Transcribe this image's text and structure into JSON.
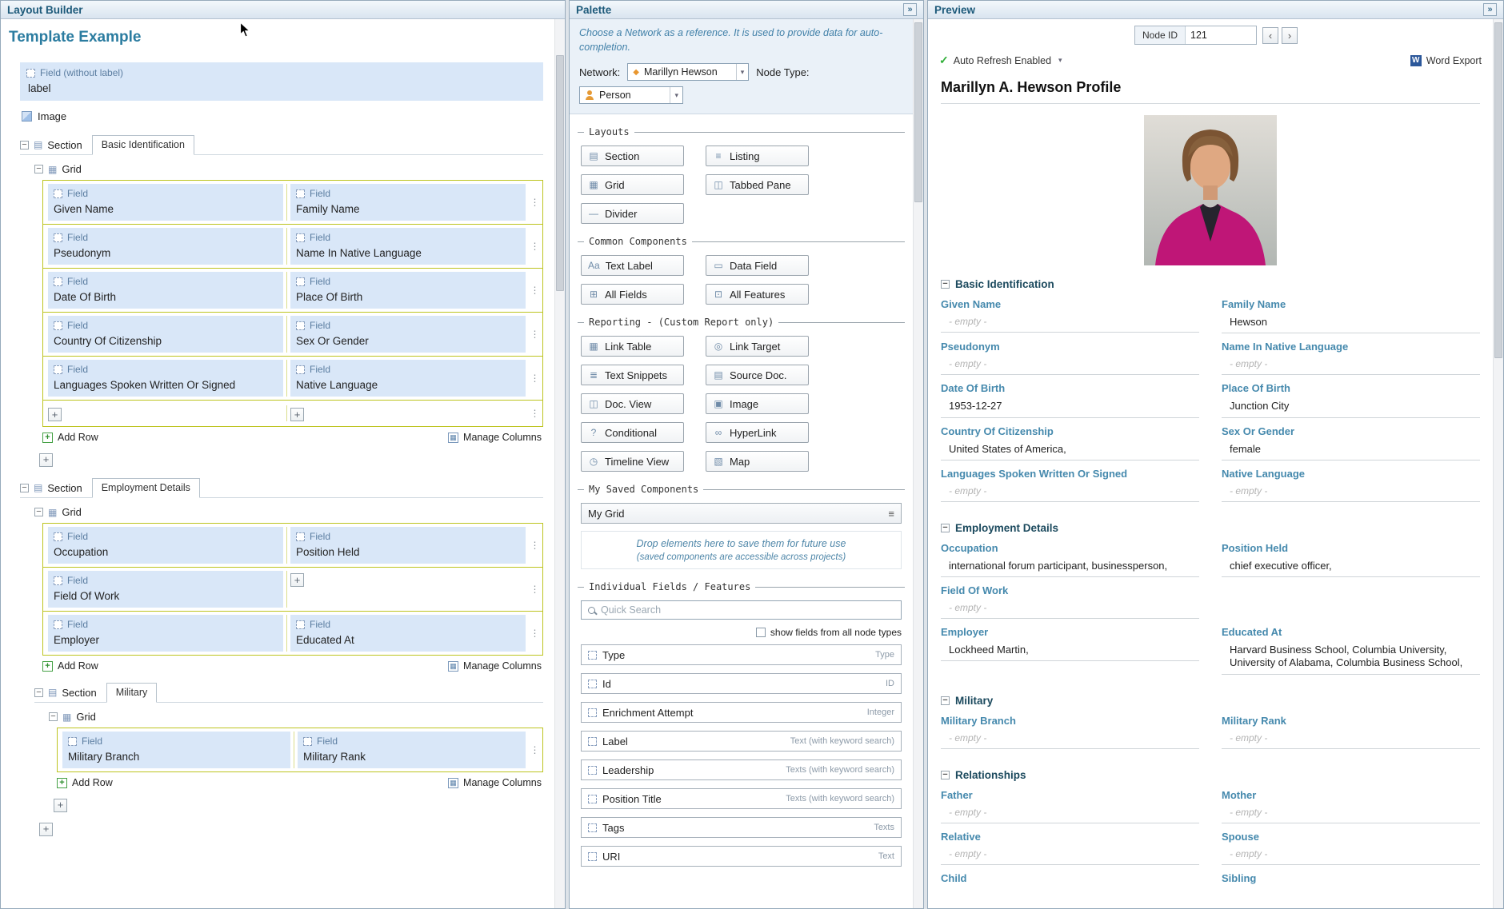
{
  "icons": {
    "collapse_panel": "»",
    "caret_down": "▾",
    "collapse_minus": "−",
    "drag_dots": "⋮",
    "plus": "+",
    "check": "✓",
    "hamburger": "≡",
    "prev_node": "‹",
    "next_node": "›",
    "section_tree": "▤",
    "grid_tree": "▦",
    "manage_columns": "▦",
    "word_export": "W",
    "network": "◆"
  },
  "layout_builder": {
    "title": "Layout Builder",
    "subtitle": "Template Example",
    "field_no_label": {
      "type_label": "Field (without label)",
      "value": "label"
    },
    "image_label": "Image",
    "section_label": "Section",
    "grid_label": "Grid",
    "field_label": "Field",
    "add_row_label": "Add Row",
    "manage_columns_label": "Manage Columns",
    "sections": [
      {
        "name": "Basic Identification",
        "plus_row": true,
        "rows": [
          [
            {
              "name": "Given Name"
            },
            {
              "name": "Family Name"
            }
          ],
          [
            {
              "name": "Pseudonym"
            },
            {
              "name": "Name In Native Language"
            }
          ],
          [
            {
              "name": "Date Of Birth"
            },
            {
              "name": "Place Of Birth"
            }
          ],
          [
            {
              "name": "Country Of Citizenship"
            },
            {
              "name": "Sex Or Gender"
            }
          ],
          [
            {
              "name": "Languages Spoken Written Or Signed"
            },
            {
              "name": "Native Language"
            }
          ]
        ]
      },
      {
        "name": "Employment Details",
        "plus_row": false,
        "rows": [
          [
            {
              "name": "Occupation"
            },
            {
              "name": "Position Held"
            }
          ],
          [
            {
              "name": "Field Of Work"
            },
            {
              "plus": true
            }
          ],
          [
            {
              "name": "Employer"
            },
            {
              "name": "Educated At"
            }
          ]
        ]
      },
      {
        "name": "Military",
        "plus_row": false,
        "rows": [
          [
            {
              "name": "Military Branch"
            },
            {
              "name": "Military Rank"
            }
          ]
        ]
      }
    ]
  },
  "palette": {
    "title": "Palette",
    "info_text": "Choose a Network as a reference. It is used to provide data for auto-completion.",
    "network_label": "Network:",
    "network_value": "Marillyn Hewson",
    "node_type_label": "Node Type:",
    "node_type_value": "Person",
    "groups": [
      {
        "title": "Layouts",
        "buttons": [
          {
            "label": "Section",
            "name": "palette-button-section",
            "icon": "section-layout-icon",
            "glyph": "▤"
          },
          {
            "label": "Listing",
            "name": "palette-button-listing",
            "icon": "listing-icon",
            "glyph": "≡"
          },
          {
            "label": "Grid",
            "name": "palette-button-grid",
            "icon": "grid-layout-icon",
            "glyph": "▦"
          },
          {
            "label": "Tabbed Pane",
            "name": "palette-button-tabbed-pane",
            "icon": "tabbed-pane-icon",
            "glyph": "◫"
          },
          {
            "label": "Divider",
            "name": "palette-button-divider",
            "icon": "divider-icon",
            "glyph": "—"
          }
        ]
      },
      {
        "title": "Common Components",
        "buttons": [
          {
            "label": "Text Label",
            "name": "palette-button-text-label",
            "icon": "text-label-icon",
            "glyph": "Aa"
          },
          {
            "label": "Data Field",
            "name": "palette-button-data-field",
            "icon": "data-field-icon",
            "glyph": "▭"
          },
          {
            "label": "All Fields",
            "name": "palette-button-all-fields",
            "icon": "all-fields-icon",
            "glyph": "⊞"
          },
          {
            "label": "All Features",
            "name": "palette-button-all-features",
            "icon": "all-features-icon",
            "glyph": "⊡"
          }
        ]
      },
      {
        "title": "Reporting - (Custom Report only)",
        "buttons": [
          {
            "label": "Link Table",
            "name": "palette-button-link-table",
            "icon": "link-table-icon",
            "glyph": "▦"
          },
          {
            "label": "Link Target",
            "name": "palette-button-link-target",
            "icon": "link-target-icon",
            "glyph": "◎"
          },
          {
            "label": "Text Snippets",
            "name": "palette-button-text-snippets",
            "icon": "text-snippets-icon",
            "glyph": "≣"
          },
          {
            "label": "Source Doc.",
            "name": "palette-button-source-doc",
            "icon": "source-doc-icon",
            "glyph": "▤"
          },
          {
            "label": "Doc. View",
            "name": "palette-button-doc-view",
            "icon": "doc-view-icon",
            "glyph": "◫"
          },
          {
            "label": "Image",
            "name": "palette-button-image",
            "icon": "image-icon",
            "glyph": "▣"
          },
          {
            "label": "Conditional",
            "name": "palette-button-conditional",
            "icon": "conditional-icon",
            "glyph": "?"
          },
          {
            "label": "HyperLink",
            "name": "palette-button-hyperlink",
            "icon": "hyperlink-icon",
            "glyph": "∞"
          },
          {
            "label": "Timeline View",
            "name": "palette-button-timeline-view",
            "icon": "timeline-view-icon",
            "glyph": "◷"
          },
          {
            "label": "Map",
            "name": "palette-button-map",
            "icon": "map-icon",
            "glyph": "▧"
          }
        ]
      }
    ],
    "saved_title": "My Saved Components",
    "saved_item": "My Grid",
    "drop_hint_1": "Drop elements here to save them for future use",
    "drop_hint_2": "(saved components are accessible across projects)",
    "fields_title": "Individual Fields / Features",
    "search_placeholder": "Quick Search",
    "show_all_label": "show fields from all node types",
    "fields": [
      {
        "name": "Type",
        "type": "Type"
      },
      {
        "name": "Id",
        "type": "ID"
      },
      {
        "name": "Enrichment Attempt",
        "type": "Integer"
      },
      {
        "name": "Label",
        "type": "Text (with keyword search)"
      },
      {
        "name": "Leadership",
        "type": "Texts (with keyword search)"
      },
      {
        "name": "Position Title",
        "type": "Texts (with keyword search)"
      },
      {
        "name": "Tags",
        "type": "Texts"
      },
      {
        "name": "URI",
        "type": "Text"
      }
    ]
  },
  "preview": {
    "title": "Preview",
    "node_id_label": "Node ID",
    "node_id_value": "121",
    "auto_refresh_label": "Auto Refresh Enabled",
    "word_export_label": "Word Export",
    "profile_title": "Marillyn A. Hewson Profile",
    "sections": [
      {
        "name": "Basic Identification",
        "fields": [
          {
            "label": "Given Name",
            "value": "- empty -",
            "empty": true
          },
          {
            "label": "Family Name",
            "value": "Hewson"
          },
          {
            "label": "Pseudonym",
            "value": "- empty -",
            "empty": true
          },
          {
            "label": "Name In Native Language",
            "value": "- empty -",
            "empty": true
          },
          {
            "label": "Date Of Birth",
            "value": "1953-12-27"
          },
          {
            "label": "Place Of Birth",
            "value": "Junction City"
          },
          {
            "label": "Country Of Citizenship",
            "value": "United States of America,"
          },
          {
            "label": "Sex Or Gender",
            "value": "female"
          },
          {
            "label": "Languages Spoken Written Or Signed",
            "value": "- empty -",
            "empty": true
          },
          {
            "label": "Native Language",
            "value": "- empty -",
            "empty": true
          }
        ]
      },
      {
        "name": "Employment Details",
        "fields": [
          {
            "label": "Occupation",
            "value": "international forum participant, businessperson,"
          },
          {
            "label": "Position Held",
            "value": "chief executive officer,"
          },
          {
            "label": "Field Of Work",
            "value": "- empty -",
            "empty": true
          },
          {
            "blank": true
          },
          {
            "label": "Employer",
            "value": "Lockheed Martin,"
          },
          {
            "label": "Educated At",
            "value": "Harvard Business School, Columbia University, University of Alabama, Columbia Business School,"
          }
        ]
      },
      {
        "name": "Military",
        "fields": [
          {
            "label": "Military Branch",
            "value": "- empty -",
            "empty": true
          },
          {
            "label": "Military Rank",
            "value": "- empty -",
            "empty": true
          }
        ]
      },
      {
        "name": "Relationships",
        "fields": [
          {
            "label": "Father",
            "value": "- empty -",
            "empty": true
          },
          {
            "label": "Mother",
            "value": "- empty -",
            "empty": true
          },
          {
            "label": "Relative",
            "value": "- empty -",
            "empty": true
          },
          {
            "label": "Spouse",
            "value": "- empty -",
            "empty": true
          },
          {
            "label": "Child",
            "value": "",
            "cut": true
          },
          {
            "label": "Sibling",
            "value": "",
            "cut": true
          }
        ]
      }
    ]
  }
}
